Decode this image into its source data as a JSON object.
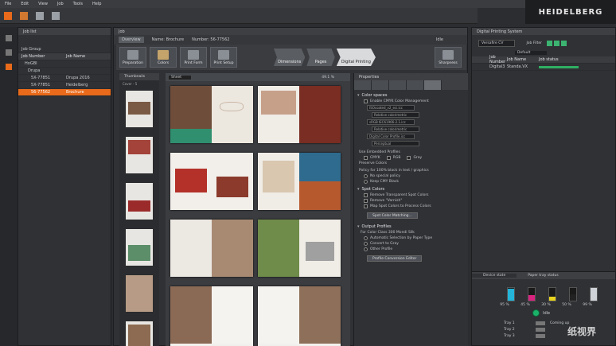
{
  "menu": [
    "File",
    "Edit",
    "View",
    "Job",
    "Tools",
    "Help"
  ],
  "brand": {
    "name": "HEIDELBERG",
    "accent": "#e86a1a"
  },
  "jobs": {
    "title": "Job list",
    "filter_label": "Job Group",
    "columns": [
      "Job Number",
      "Job Name",
      ""
    ],
    "rows": [
      {
        "num": "HoGBI",
        "name": "",
        "flag": ""
      },
      {
        "num": "Drupa",
        "name": "",
        "flag": ""
      },
      {
        "num": "5X-77851",
        "name": "Drupa 2016",
        "flag": ""
      },
      {
        "num": "5X-77851",
        "name": "Heidelberg",
        "flag": ""
      },
      {
        "num": "56-77562",
        "name": "Brochure",
        "flag": ""
      }
    ],
    "selected_index": 4
  },
  "center": {
    "title": "Job",
    "overview_tab": "Overview",
    "job_name_label": "Name: Brochure",
    "job_number_label": "Number: 56-77562",
    "state": "Idle",
    "modes": [
      "Preparation",
      "Colors",
      "Print Form",
      "Print Setup"
    ],
    "steps": [
      "Dimensions",
      "Pages",
      "Digital Printing"
    ],
    "active_step": "Digital Printing",
    "right_mode": "Sharpness",
    "thumbs_title": "Thumbnails",
    "thumbs_sub": "Cover - 5",
    "sheet_view": "Sheet",
    "zoom": "49.1 %"
  },
  "props": {
    "title": "Properties",
    "color_spaces": "Color spaces",
    "cms_label": "Enable CMYK Color Management",
    "profile1": "ISOcoated_v2_eci.icc",
    "intent1": "Relative colorimetric",
    "profile2": "sRGB IEC61966-2.1.icc",
    "intent2": "Relative colorimetric",
    "profile3": "Digital Color Profile.icc",
    "intent3": "Perceptual",
    "embedded": "Use Embedded Profiles",
    "embedded_opts": [
      "CMYK",
      "RGB",
      "Gray"
    ],
    "preserve": "Preserve Colors",
    "policy": "Policy for 100% black in text / graphics",
    "policy_opts": [
      "No special policy",
      "Keep CMY Black"
    ],
    "spot": "Spot Colors",
    "spot_opts": [
      "Remove Transparent Spot Colors",
      "Remove \"Varnish\""
    ],
    "map_spot": "Map Spot Colors to Process Colors",
    "spot_btn": "Spot Color Matching...",
    "output": "Output Profiles",
    "output_sub": "For Color Class 300 Mondi Silk",
    "output_opts": [
      "Automatic Selection by Paper Type",
      "Convert to Gray",
      "Other Profile"
    ],
    "output_btn": "Profile Conversion Editor"
  },
  "dps": {
    "title": "Digital Printing System",
    "select": "Versafire CV",
    "filter": "Job Filter",
    "default": "Default",
    "columns": [
      "Job Number",
      "Job Name",
      "Job status"
    ],
    "row": {
      "num": "Digital3",
      "name": "Standa.VX"
    },
    "device_title": "Device state",
    "device_tab2": "Paper tray status",
    "toners": [
      {
        "label": "95 %",
        "level": 0.95,
        "color": "#23b4d8"
      },
      {
        "label": "45 %",
        "level": 0.45,
        "color": "#d8237f"
      },
      {
        "label": "30 %",
        "level": 0.3,
        "color": "#e8d31d"
      },
      {
        "label": "50 %",
        "level": 0.5,
        "color": "#222222"
      },
      {
        "label": "99 %",
        "level": 0.99,
        "color": "#cfd2d6"
      }
    ],
    "status": "Idle",
    "trays": [
      "Tray 1",
      "Tray 2",
      "Tray 3"
    ],
    "tray_text": "Coming up"
  },
  "watermark": "纸视界"
}
